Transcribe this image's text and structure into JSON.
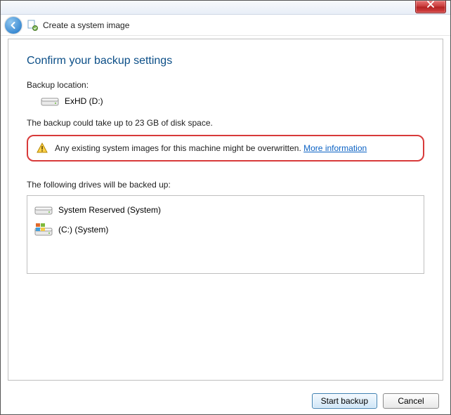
{
  "window": {
    "title": "Create a system image"
  },
  "page": {
    "heading": "Confirm your backup settings",
    "backup_location_label": "Backup location:",
    "backup_location_value": "ExHD (D:)",
    "disk_space_text": "The backup could take up to 23 GB of disk space.",
    "warning_text": "Any existing system images for this machine might be overwritten. ",
    "warning_link": "More information",
    "drives_label": "The following drives will be backed up:",
    "drives": [
      {
        "name": "System Reserved (System)"
      },
      {
        "name": "(C:) (System)"
      }
    ]
  },
  "buttons": {
    "start": "Start backup",
    "cancel": "Cancel"
  }
}
